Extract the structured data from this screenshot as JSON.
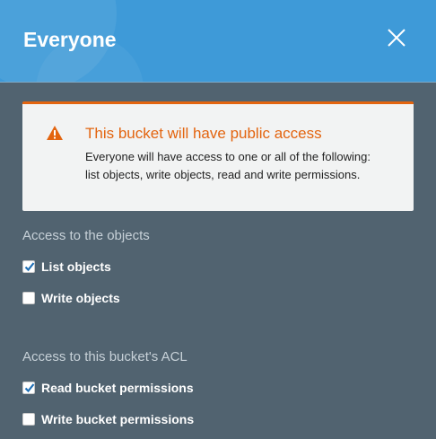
{
  "dialog": {
    "title": "Everyone",
    "close_icon": "close-icon"
  },
  "alert": {
    "icon": "warning-icon",
    "title": "This bucket will have public access",
    "body": "Everyone will have access to one or all of the following: list objects, write objects, read and write permissions.",
    "accent_color": "#e3640f"
  },
  "objects_section": {
    "title": "Access to the objects",
    "options": [
      {
        "label": "List objects",
        "checked": true
      },
      {
        "label": "Write objects",
        "checked": false
      }
    ]
  },
  "acl_section": {
    "title": "Access to this bucket's ACL",
    "options": [
      {
        "label": "Read bucket permissions",
        "checked": true
      },
      {
        "label": "Write bucket permissions",
        "checked": false
      }
    ]
  },
  "colors": {
    "header": "#3e9ad8",
    "panel": "#516370"
  }
}
